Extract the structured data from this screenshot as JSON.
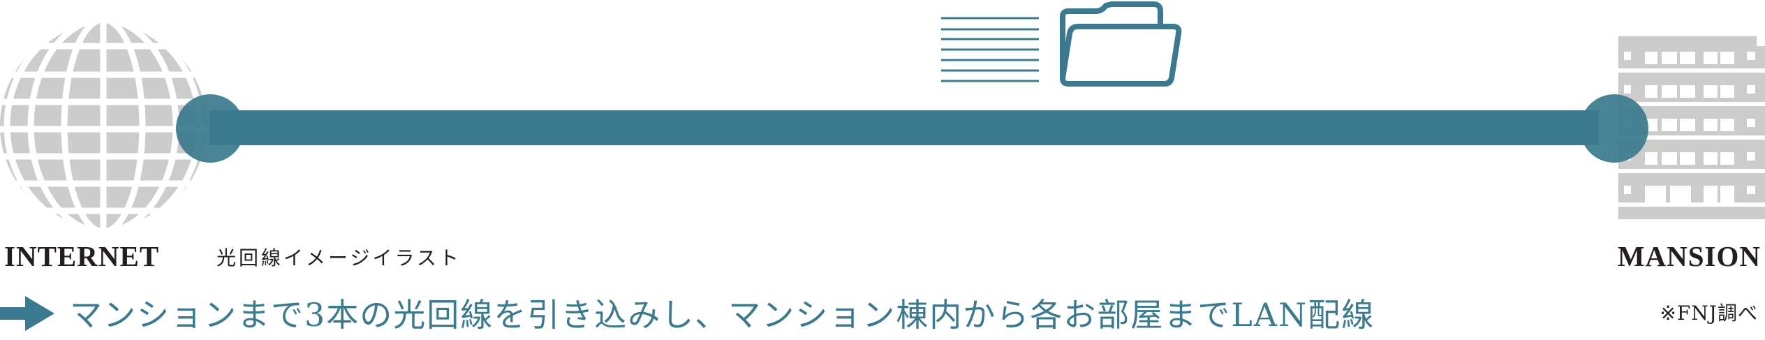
{
  "diagram": {
    "left_label": "INTERNET",
    "left_caption": "光回線イメージイラスト",
    "right_label": "MANSION",
    "description": "マンションまで3本の光回線を引き込みし、マンション棟内から各お部屋までLAN配線",
    "note": "※FNJ調べ"
  },
  "icons": {
    "globe": "globe-icon",
    "building": "building-icon",
    "document": "document-lines-icon",
    "folder": "folder-icon",
    "arrow": "arrow-right-icon"
  },
  "colors": {
    "accent": "#3b7a8e",
    "icon_gray": "#cccccc",
    "text_dark": "#231f20"
  }
}
